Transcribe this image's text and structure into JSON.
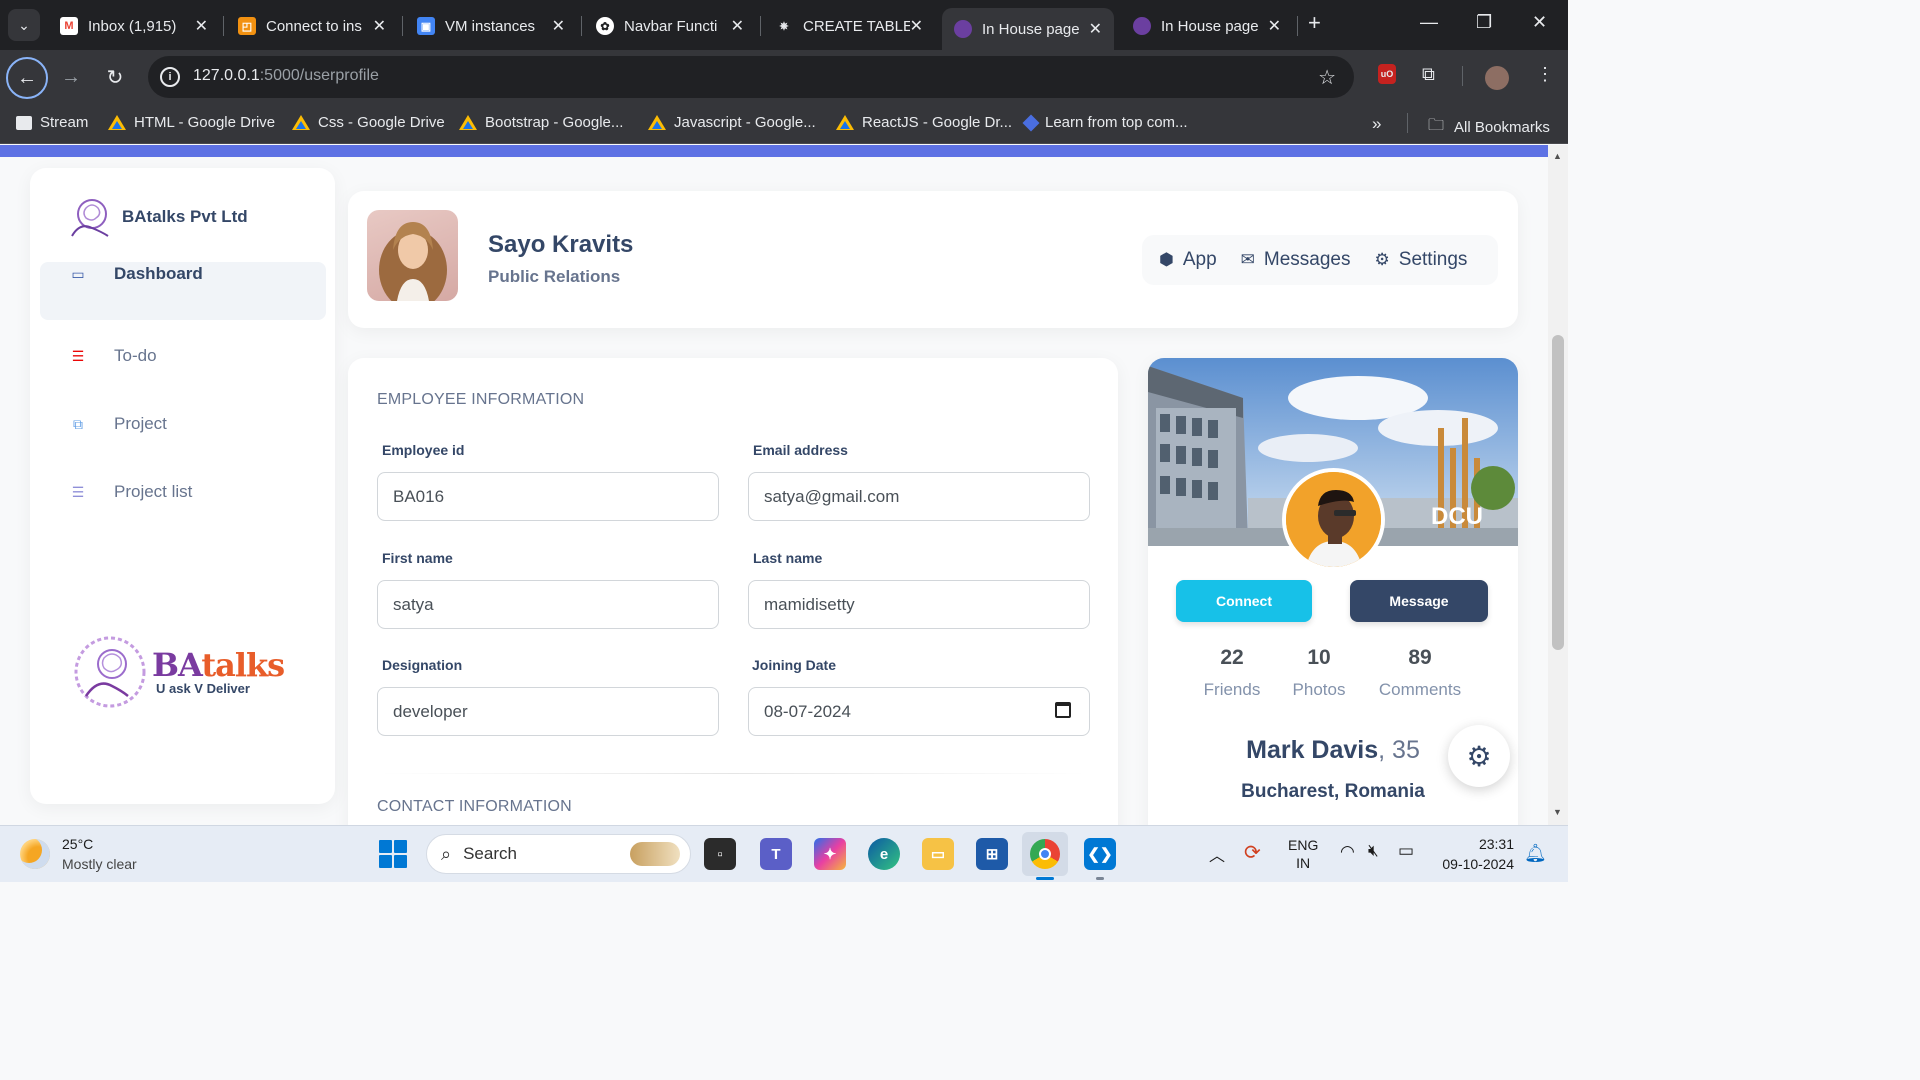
{
  "browser": {
    "tabs": [
      {
        "label": "Inbox (1,915)",
        "icon": "gmail-icon"
      },
      {
        "label": "Connect to ins",
        "icon": "aws-icon"
      },
      {
        "label": "VM instances",
        "icon": "gcp-icon"
      },
      {
        "label": "Navbar Functi",
        "icon": "chatgpt-icon"
      },
      {
        "label": "CREATE TABLE",
        "icon": "gear-favicon-icon"
      },
      {
        "label": "In House page",
        "icon": "batalks-favicon-icon",
        "active": true
      },
      {
        "label": "In House page",
        "icon": "batalks-favicon-icon"
      }
    ],
    "url_host": "127.0.0.1",
    "url_path": ":5000/userprofile",
    "bookmarks": [
      "Stream",
      "HTML - Google Drive",
      "Css - Google Drive",
      "Bootstrap - Google...",
      "Javascript - Google...",
      "ReactJS - Google Dr...",
      "Learn from top com..."
    ],
    "all_bookmarks": "All Bookmarks"
  },
  "sidebar": {
    "brand": "BAtalks Pvt Ltd",
    "items": [
      {
        "label": "Dashboard",
        "icon": "monitor-icon",
        "active": true
      },
      {
        "label": "To-do",
        "icon": "list-icon"
      },
      {
        "label": "Project",
        "icon": "project-icon"
      },
      {
        "label": "Project list",
        "icon": "project-list-icon"
      }
    ],
    "logo_name_1": "BA",
    "logo_name_2": "talks",
    "logo_tagline": "U ask V Deliver"
  },
  "profile_header": {
    "name": "Sayo Kravits",
    "role": "Public Relations",
    "tabs": [
      {
        "label": "App",
        "icon": "cube-icon"
      },
      {
        "label": "Messages",
        "icon": "envelope-icon"
      },
      {
        "label": "Settings",
        "icon": "gear-icon"
      }
    ]
  },
  "employee": {
    "section_title": "EMPLOYEE INFORMATION",
    "fields": {
      "employee_id": {
        "label": "Employee id",
        "value": "BA016"
      },
      "email": {
        "label": "Email address",
        "value": "satya@gmail.com"
      },
      "first_name": {
        "label": "First name",
        "value": "satya"
      },
      "last_name": {
        "label": "Last name",
        "value": "mamidisetty"
      },
      "designation": {
        "label": "Designation",
        "value": "developer"
      },
      "joining_date": {
        "label": "Joining Date",
        "value": "08-07-2024"
      }
    },
    "contact_title": "CONTACT INFORMATION"
  },
  "side_card": {
    "cover_sign": "DCU",
    "connect_label": "Connect",
    "message_label": "Message",
    "stats": [
      {
        "value": "22",
        "label": "Friends"
      },
      {
        "value": "10",
        "label": "Photos"
      },
      {
        "value": "89",
        "label": "Comments"
      }
    ],
    "person_name": "Mark Davis",
    "person_age": ", 35",
    "location": "Bucharest, Romania"
  },
  "taskbar": {
    "temperature": "25°C",
    "weather": "Mostly clear",
    "search_placeholder": "Search",
    "lang_1": "ENG",
    "lang_2": "IN",
    "time": "23:31",
    "date": "09-10-2024"
  },
  "colors": {
    "accent": "#5e72e4",
    "connect": "#17c1e8",
    "message": "#344767"
  }
}
